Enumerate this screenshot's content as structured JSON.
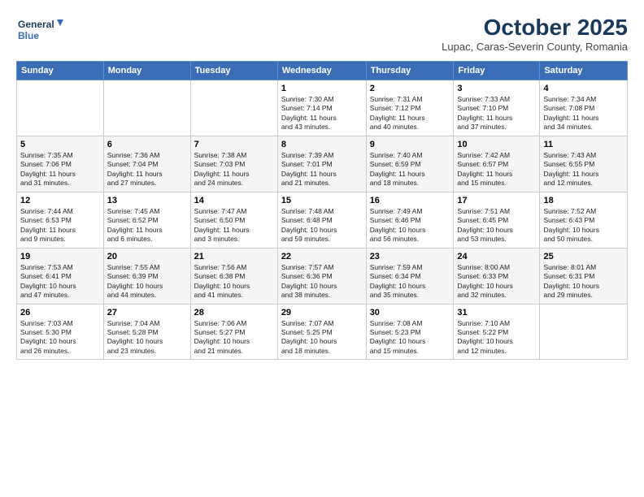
{
  "logo": {
    "line1": "General",
    "line2": "Blue"
  },
  "title": "October 2025",
  "subtitle": "Lupac, Caras-Severin County, Romania",
  "days_header": [
    "Sunday",
    "Monday",
    "Tuesday",
    "Wednesday",
    "Thursday",
    "Friday",
    "Saturday"
  ],
  "weeks": [
    [
      {
        "day": "",
        "info": ""
      },
      {
        "day": "",
        "info": ""
      },
      {
        "day": "",
        "info": ""
      },
      {
        "day": "1",
        "info": "Sunrise: 7:30 AM\nSunset: 7:14 PM\nDaylight: 11 hours\nand 43 minutes."
      },
      {
        "day": "2",
        "info": "Sunrise: 7:31 AM\nSunset: 7:12 PM\nDaylight: 11 hours\nand 40 minutes."
      },
      {
        "day": "3",
        "info": "Sunrise: 7:33 AM\nSunset: 7:10 PM\nDaylight: 11 hours\nand 37 minutes."
      },
      {
        "day": "4",
        "info": "Sunrise: 7:34 AM\nSunset: 7:08 PM\nDaylight: 11 hours\nand 34 minutes."
      }
    ],
    [
      {
        "day": "5",
        "info": "Sunrise: 7:35 AM\nSunset: 7:06 PM\nDaylight: 11 hours\nand 31 minutes."
      },
      {
        "day": "6",
        "info": "Sunrise: 7:36 AM\nSunset: 7:04 PM\nDaylight: 11 hours\nand 27 minutes."
      },
      {
        "day": "7",
        "info": "Sunrise: 7:38 AM\nSunset: 7:03 PM\nDaylight: 11 hours\nand 24 minutes."
      },
      {
        "day": "8",
        "info": "Sunrise: 7:39 AM\nSunset: 7:01 PM\nDaylight: 11 hours\nand 21 minutes."
      },
      {
        "day": "9",
        "info": "Sunrise: 7:40 AM\nSunset: 6:59 PM\nDaylight: 11 hours\nand 18 minutes."
      },
      {
        "day": "10",
        "info": "Sunrise: 7:42 AM\nSunset: 6:57 PM\nDaylight: 11 hours\nand 15 minutes."
      },
      {
        "day": "11",
        "info": "Sunrise: 7:43 AM\nSunset: 6:55 PM\nDaylight: 11 hours\nand 12 minutes."
      }
    ],
    [
      {
        "day": "12",
        "info": "Sunrise: 7:44 AM\nSunset: 6:53 PM\nDaylight: 11 hours\nand 9 minutes."
      },
      {
        "day": "13",
        "info": "Sunrise: 7:45 AM\nSunset: 6:52 PM\nDaylight: 11 hours\nand 6 minutes."
      },
      {
        "day": "14",
        "info": "Sunrise: 7:47 AM\nSunset: 6:50 PM\nDaylight: 11 hours\nand 3 minutes."
      },
      {
        "day": "15",
        "info": "Sunrise: 7:48 AM\nSunset: 6:48 PM\nDaylight: 10 hours\nand 59 minutes."
      },
      {
        "day": "16",
        "info": "Sunrise: 7:49 AM\nSunset: 6:46 PM\nDaylight: 10 hours\nand 56 minutes."
      },
      {
        "day": "17",
        "info": "Sunrise: 7:51 AM\nSunset: 6:45 PM\nDaylight: 10 hours\nand 53 minutes."
      },
      {
        "day": "18",
        "info": "Sunrise: 7:52 AM\nSunset: 6:43 PM\nDaylight: 10 hours\nand 50 minutes."
      }
    ],
    [
      {
        "day": "19",
        "info": "Sunrise: 7:53 AM\nSunset: 6:41 PM\nDaylight: 10 hours\nand 47 minutes."
      },
      {
        "day": "20",
        "info": "Sunrise: 7:55 AM\nSunset: 6:39 PM\nDaylight: 10 hours\nand 44 minutes."
      },
      {
        "day": "21",
        "info": "Sunrise: 7:56 AM\nSunset: 6:38 PM\nDaylight: 10 hours\nand 41 minutes."
      },
      {
        "day": "22",
        "info": "Sunrise: 7:57 AM\nSunset: 6:36 PM\nDaylight: 10 hours\nand 38 minutes."
      },
      {
        "day": "23",
        "info": "Sunrise: 7:59 AM\nSunset: 6:34 PM\nDaylight: 10 hours\nand 35 minutes."
      },
      {
        "day": "24",
        "info": "Sunrise: 8:00 AM\nSunset: 6:33 PM\nDaylight: 10 hours\nand 32 minutes."
      },
      {
        "day": "25",
        "info": "Sunrise: 8:01 AM\nSunset: 6:31 PM\nDaylight: 10 hours\nand 29 minutes."
      }
    ],
    [
      {
        "day": "26",
        "info": "Sunrise: 7:03 AM\nSunset: 5:30 PM\nDaylight: 10 hours\nand 26 minutes."
      },
      {
        "day": "27",
        "info": "Sunrise: 7:04 AM\nSunset: 5:28 PM\nDaylight: 10 hours\nand 23 minutes."
      },
      {
        "day": "28",
        "info": "Sunrise: 7:06 AM\nSunset: 5:27 PM\nDaylight: 10 hours\nand 21 minutes."
      },
      {
        "day": "29",
        "info": "Sunrise: 7:07 AM\nSunset: 5:25 PM\nDaylight: 10 hours\nand 18 minutes."
      },
      {
        "day": "30",
        "info": "Sunrise: 7:08 AM\nSunset: 5:23 PM\nDaylight: 10 hours\nand 15 minutes."
      },
      {
        "day": "31",
        "info": "Sunrise: 7:10 AM\nSunset: 5:22 PM\nDaylight: 10 hours\nand 12 minutes."
      },
      {
        "day": "",
        "info": ""
      }
    ]
  ]
}
